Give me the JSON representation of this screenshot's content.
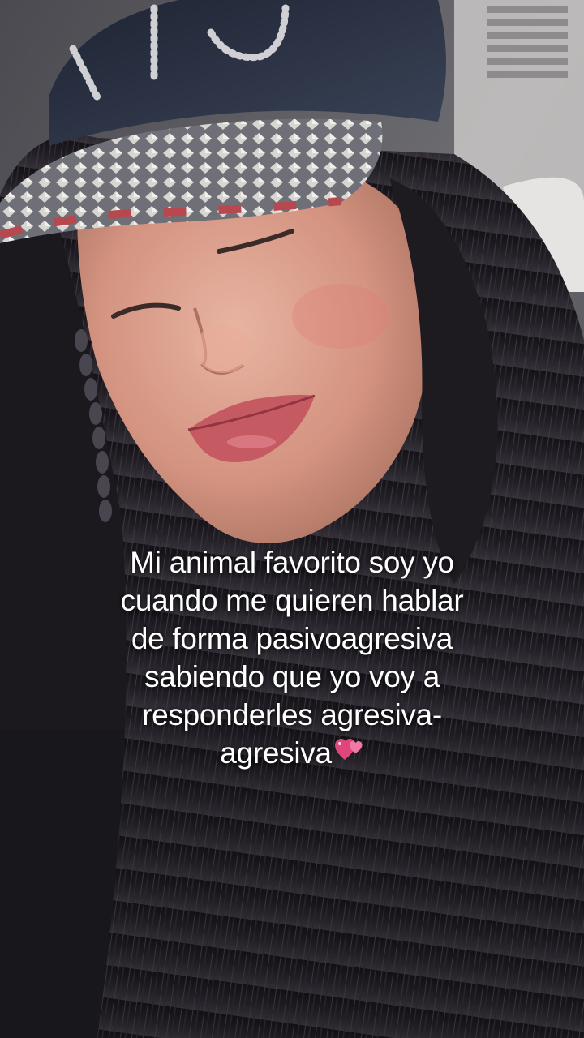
{
  "caption": {
    "lines": [
      "Mi animal favorito soy yo",
      "cuando me quieren hablar",
      "de forma pasivoagresiva",
      "sabiendo que yo voy a",
      "responderles agresiva-",
      "agresiva"
    ],
    "emoji": "two-hearts-icon"
  },
  "colors": {
    "caption_text": "#ffffff",
    "hair": "#1c1a1f",
    "cap": "#2b3346",
    "skin": "#d99a87",
    "lips": "#c65a62",
    "emoji": "#e0457b"
  }
}
